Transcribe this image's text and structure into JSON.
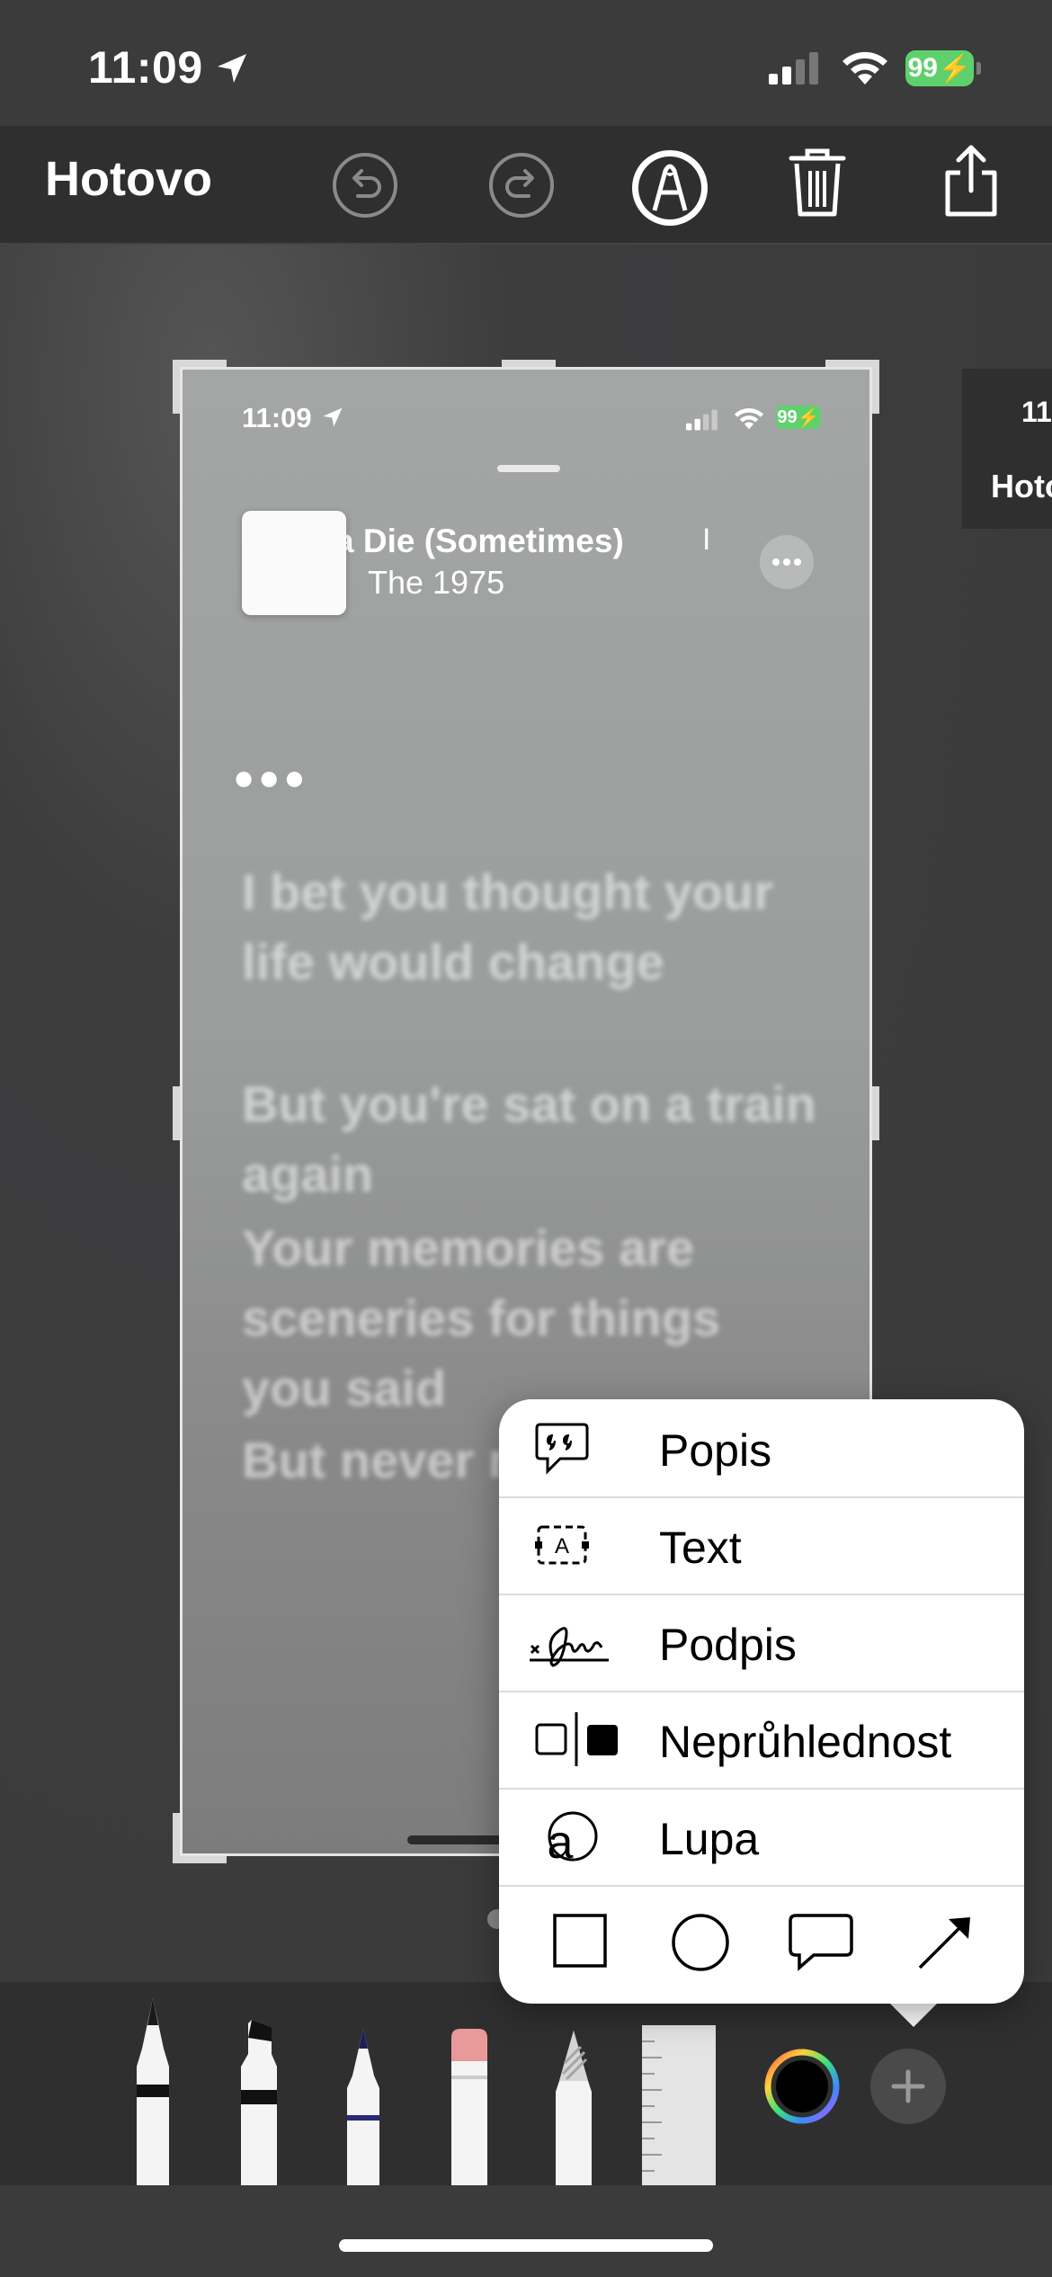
{
  "status_bar": {
    "time": "11:09",
    "battery": "99"
  },
  "toolbar": {
    "done_label": "Hotovo"
  },
  "screenshot": {
    "status_time": "11:09",
    "battery": "99",
    "song_title": "a Die (Sometimes)",
    "song_title_extra": "I",
    "artist": "The 1975",
    "loading_dots": "●●●",
    "lyrics": [
      "I bet you thought your life would change",
      "But you're sat on a train again",
      "Your memories are sceneries for things you said",
      "But never really meant"
    ]
  },
  "peek": {
    "time": "11:",
    "label": "Hoto"
  },
  "menu": {
    "items": [
      {
        "label": "Popis",
        "icon": "quote-bubble-icon"
      },
      {
        "label": "Text",
        "icon": "text-box-icon"
      },
      {
        "label": "Podpis",
        "icon": "signature-icon"
      },
      {
        "label": "Neprůhlednost",
        "icon": "opacity-icon"
      },
      {
        "label": "Lupa",
        "icon": "magnifier-icon"
      }
    ],
    "shapes": [
      "square-shape-icon",
      "circle-shape-icon",
      "speech-bubble-shape-icon",
      "arrow-shape-icon"
    ]
  },
  "tools": [
    "pen",
    "marker",
    "pencil",
    "eraser",
    "lasso",
    "ruler",
    "color-picker",
    "add"
  ]
}
